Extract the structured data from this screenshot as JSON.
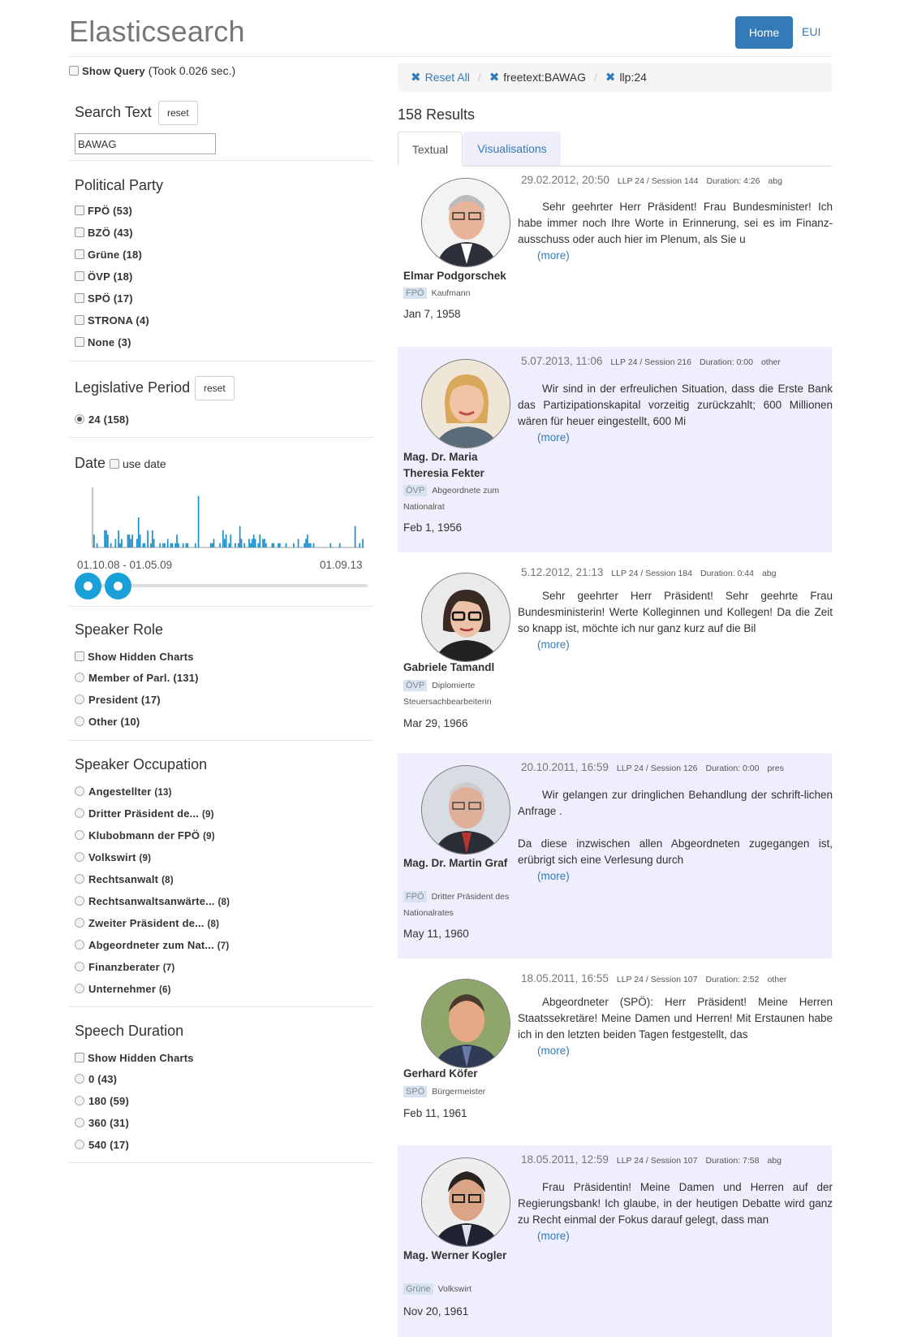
{
  "header": {
    "brand": "Elasticsearch",
    "nav_home": "Home",
    "nav_eui": "EUI"
  },
  "query": {
    "show_query_label": "Show Query",
    "took": "(Took 0.026 sec.)"
  },
  "search": {
    "title": "Search Text",
    "reset": "reset",
    "value": "BAWAG"
  },
  "party_facet": {
    "title": "Political Party",
    "items": [
      {
        "label": "FPÖ (53)"
      },
      {
        "label": "BZÖ (43)"
      },
      {
        "label": "Grüne (18)"
      },
      {
        "label": "ÖVP (18)"
      },
      {
        "label": "SPÖ (17)"
      },
      {
        "label": "STRONA (4)"
      },
      {
        "label": "None (3)"
      }
    ]
  },
  "period_facet": {
    "title": "Legislative Period",
    "reset": "reset",
    "items": [
      {
        "label": "24 (158)",
        "selected": true
      }
    ]
  },
  "date_facet": {
    "title": "Date",
    "use_date_label": "use date",
    "range_start_label": "01.10.08 - 01.05.09",
    "range_end_label": "01.09.13",
    "slider_handles": [
      0.0,
      0.1
    ]
  },
  "role_facet": {
    "title": "Speaker Role",
    "hidden_charts": "Show Hidden Charts",
    "items": [
      {
        "label": "Member of Parl. (131)"
      },
      {
        "label": "President (17)"
      },
      {
        "label": "Other (10)"
      }
    ]
  },
  "occupation_facet": {
    "title": "Speaker Occupation",
    "items": [
      {
        "label": "Angestellter",
        "count": "(13)"
      },
      {
        "label": "Dritter Präsident de...",
        "count": "(9)"
      },
      {
        "label": "Klubobmann der FPÖ",
        "count": "(9)"
      },
      {
        "label": "Volkswirt",
        "count": "(9)"
      },
      {
        "label": "Rechtsanwalt",
        "count": "(8)"
      },
      {
        "label": "Rechtsanwaltsanwärte...",
        "count": "(8)"
      },
      {
        "label": "Zweiter Präsident de...",
        "count": "(8)"
      },
      {
        "label": "Abgeordneter zum Nat...",
        "count": "(7)"
      },
      {
        "label": "Finanzberater",
        "count": "(7)"
      },
      {
        "label": "Unternehmer",
        "count": "(6)"
      }
    ]
  },
  "duration_facet": {
    "title": "Speech Duration",
    "hidden_charts": "Show Hidden Charts",
    "items": [
      {
        "label": "0 (43)"
      },
      {
        "label": "180 (59)"
      },
      {
        "label": "360 (31)"
      },
      {
        "label": "540 (17)"
      }
    ]
  },
  "breadcrumbs": {
    "reset_all": "Reset All",
    "items": [
      "freetext:BAWAG",
      "llp:24"
    ]
  },
  "results": {
    "count_label": "158 Results",
    "tabs": [
      "Textual",
      "Visualisations"
    ],
    "more": "(more)",
    "items": [
      {
        "datetime": "29.02.2012, 20:50",
        "session": "LLP 24 / Session 144",
        "duration": "Duration: 4:26",
        "type": "abg",
        "text": "Sehr geehrter Herr Präsident! Frau Bundesminister! Ich habe immer noch Ihre Worte in Erinnerung, sei es im Finanz-ausschuss oder auch hier im Plenum, als Sie u",
        "name": "Elmar Podgorschek",
        "party": "FPÖ",
        "occupation": "Kaufmann",
        "dob": "Jan 7, 1958"
      },
      {
        "datetime": "5.07.2013, 11:06",
        "session": "LLP 24 / Session 216",
        "duration": "Duration: 0:00",
        "type": "other",
        "text": "Wir sind in der erfreulichen Situation, dass die Erste Bank das Partizipationskapital vorzeitig zurückzahlt; 600 Millionen wären für heuer eingestellt, 600 Mi",
        "name": "Mag. Dr. Maria Theresia Fekter",
        "party": "ÖVP",
        "occupation": "Abgeordnete zum Nationalrat",
        "dob": "Feb 1, 1956"
      },
      {
        "datetime": "5.12.2012, 21:13",
        "session": "LLP 24 / Session 184",
        "duration": "Duration: 0:44",
        "type": "abg",
        "text": "Sehr geehrter Herr Präsident! Sehr geehrte Frau Bundesministerin! Werte Kolleginnen und Kollegen! Da die Zeit so knapp ist, möchte ich nur ganz kurz auf die Bil",
        "name": "Gabriele Tamandl",
        "party": "ÖVP",
        "occupation": "Diplomierte Steuersachbearbeiterin",
        "dob": "Mar 29, 1966"
      },
      {
        "datetime": "20.10.2011, 16:59",
        "session": "LLP 24 / Session 126",
        "duration": "Duration: 0:00",
        "type": "pres",
        "text": "Wir gelangen zur dringlichen Behandlung der schrift-lichen Anfrage .",
        "text2": "Da diese inzwischen allen Abgeordneten zugegangen ist, erübrigt sich eine Verlesung durch",
        "name": "Mag. Dr. Martin Graf",
        "party": "FPÖ",
        "occupation": "Dritter Präsident des Nationalrates",
        "dob": "May 11, 1960"
      },
      {
        "datetime": "18.05.2011, 16:55",
        "session": "LLP 24 / Session 107",
        "duration": "Duration: 2:52",
        "type": "other",
        "text": "Abgeordneter  (SPÖ): Herr Präsident! Meine Herren Staatssekretäre! Meine Damen und Herren! Mit Erstaunen habe ich in den letzten beiden Tagen festgestellt, das",
        "name": "Gerhard Köfer",
        "party": "SPÖ",
        "occupation": "Bürgermeister",
        "dob": "Feb 11, 1961"
      },
      {
        "datetime": "18.05.2011, 12:59",
        "session": "LLP 24 / Session 107",
        "duration": "Duration: 7:58",
        "type": "abg",
        "text": "Frau Präsidentin! Meine Damen und Herren auf der Regierungsbank! Ich glaube, in der heutigen Debatte wird ganz zu Recht einmal der Fokus darauf gelegt, dass man",
        "name": "Mag. Werner Kogler",
        "party": "Grüne",
        "occupation": "Volkswirt",
        "dob": "Nov 20, 1961"
      }
    ]
  },
  "chart_data": {
    "type": "bar",
    "color": "#1a8fc8",
    "values": [
      3,
      0,
      1,
      0,
      0,
      0,
      0,
      4,
      4,
      3,
      0,
      1,
      0,
      0,
      2,
      0,
      4,
      1,
      2,
      0,
      0,
      0,
      3,
      3,
      2,
      3,
      0,
      0,
      2,
      7,
      3,
      0,
      1,
      1,
      0,
      4,
      0,
      1,
      4,
      2,
      0,
      0,
      0,
      1,
      0,
      1,
      1,
      0,
      2,
      0,
      1,
      1,
      0,
      1,
      3,
      1,
      0,
      0,
      1,
      0,
      1,
      1,
      0,
      0,
      0,
      0,
      1,
      0,
      12,
      0,
      0,
      0,
      0,
      0,
      0,
      0,
      1,
      1,
      2,
      0,
      0,
      0,
      1,
      0,
      4,
      2,
      3,
      0,
      1,
      3,
      0,
      0,
      1,
      0,
      1,
      5,
      2,
      0,
      1,
      0,
      0,
      2,
      1,
      2,
      3,
      2,
      0,
      1,
      3,
      0,
      2,
      2,
      1,
      0,
      0,
      0,
      1,
      1,
      0,
      0,
      1,
      1,
      0,
      0,
      0,
      1,
      0,
      0,
      0,
      0,
      1,
      0,
      0,
      2,
      0,
      0,
      0,
      1,
      2,
      3,
      1,
      1,
      0,
      1,
      0,
      0,
      0,
      0,
      0,
      0,
      0,
      0,
      0,
      0,
      1,
      0,
      0,
      0,
      0,
      0,
      1,
      0,
      0,
      0,
      0,
      0,
      0,
      0,
      0,
      0,
      5,
      0,
      0,
      1,
      0,
      2,
      0
    ],
    "ylim": [
      0,
      14
    ]
  },
  "colors": {
    "accent": "#337ab7",
    "slider": "#1aa0d8",
    "card_alt": "#eeeefc"
  }
}
